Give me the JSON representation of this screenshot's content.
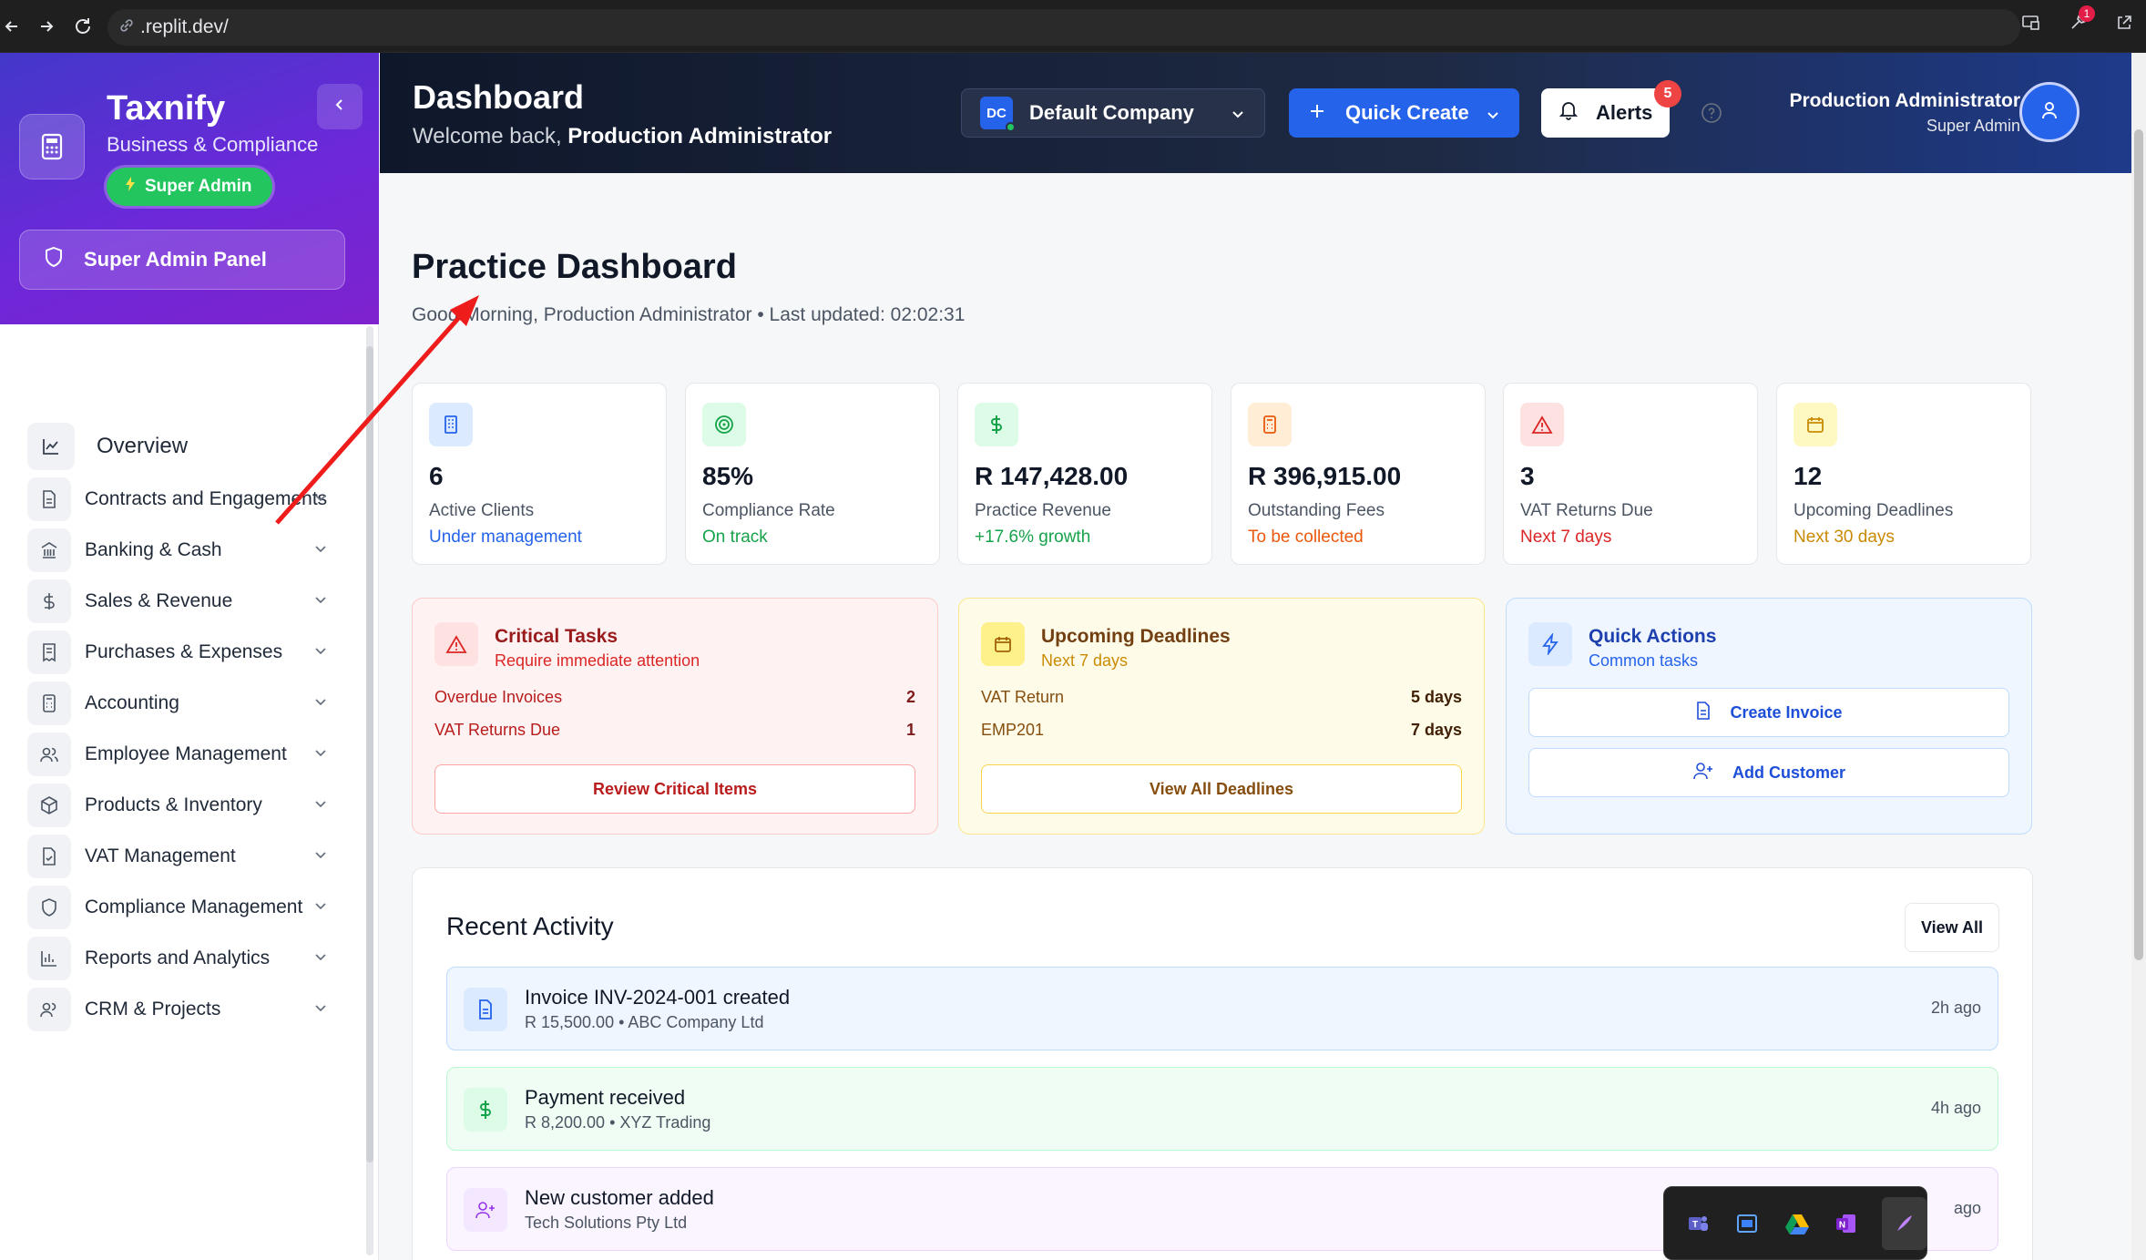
{
  "browser": {
    "url": ".replit.dev/",
    "extension_badge": "1"
  },
  "brand": {
    "name": "Taxnify",
    "tagline": "Business & Compliance",
    "badge": "Super Admin",
    "admin_panel": "Super Admin Panel"
  },
  "nav": [
    {
      "label": "Overview"
    },
    {
      "label": "Contracts and Engagements"
    },
    {
      "label": "Banking & Cash"
    },
    {
      "label": "Sales & Revenue"
    },
    {
      "label": "Purchases & Expenses"
    },
    {
      "label": "Accounting"
    },
    {
      "label": "Employee Management"
    },
    {
      "label": "Products & Inventory"
    },
    {
      "label": "VAT Management"
    },
    {
      "label": "Compliance Management"
    },
    {
      "label": "Reports and Analytics"
    },
    {
      "label": "CRM & Projects"
    }
  ],
  "header": {
    "title": "Dashboard",
    "welcome_prefix": "Welcome back, ",
    "welcome_name": "Production Administrator",
    "company_initials": "DC",
    "company": "Default Company",
    "quick_create": "Quick Create",
    "alerts": "Alerts",
    "alerts_count": "5",
    "user_name": "Production Administrator",
    "user_role": "Super Admin"
  },
  "main": {
    "title": "Practice Dashboard",
    "subtitle": "Good Morning, Production Administrator • Last updated: 02:02:31"
  },
  "stats": [
    {
      "value": "6",
      "label": "Active Clients",
      "note": "Under management",
      "color": "#2563eb"
    },
    {
      "value": "85%",
      "label": "Compliance Rate",
      "note": "On track",
      "color": "#16a34a"
    },
    {
      "value": "R 147,428.00",
      "label": "Practice Revenue",
      "note": "+17.6% growth",
      "color": "#16a34a"
    },
    {
      "value": "R 396,915.00",
      "label": "Outstanding Fees",
      "note": "To be collected",
      "color": "#ea580c"
    },
    {
      "value": "3",
      "label": "VAT Returns Due",
      "note": "Next 7 days",
      "color": "#dc2626"
    },
    {
      "value": "12",
      "label": "Upcoming Deadlines",
      "note": "Next 30 days",
      "color": "#ca8a04"
    }
  ],
  "panels": {
    "critical": {
      "title": "Critical Tasks",
      "subtitle": "Require immediate attention",
      "rows": [
        {
          "label": "Overdue Invoices",
          "value": "2"
        },
        {
          "label": "VAT Returns Due",
          "value": "1"
        }
      ],
      "button": "Review Critical Items"
    },
    "deadlines": {
      "title": "Upcoming Deadlines",
      "subtitle": "Next 7 days",
      "rows": [
        {
          "label": "VAT Return",
          "value": "5 days"
        },
        {
          "label": "EMP201",
          "value": "7 days"
        }
      ],
      "button": "View All Deadlines"
    },
    "quick": {
      "title": "Quick Actions",
      "subtitle": "Common tasks",
      "buttons": [
        "Create Invoice",
        "Add Customer"
      ]
    }
  },
  "activity": {
    "title": "Recent Activity",
    "view_all": "View All",
    "items": [
      {
        "title": "Invoice INV-2024-001 created",
        "sub": "R 15,500.00 • ABC Company Ltd",
        "time": "2h ago"
      },
      {
        "title": "Payment received",
        "sub": "R 8,200.00 • XYZ Trading",
        "time": "4h ago"
      },
      {
        "title": "New customer added",
        "sub": "Tech Solutions Pty Ltd",
        "time": "ago"
      }
    ]
  }
}
